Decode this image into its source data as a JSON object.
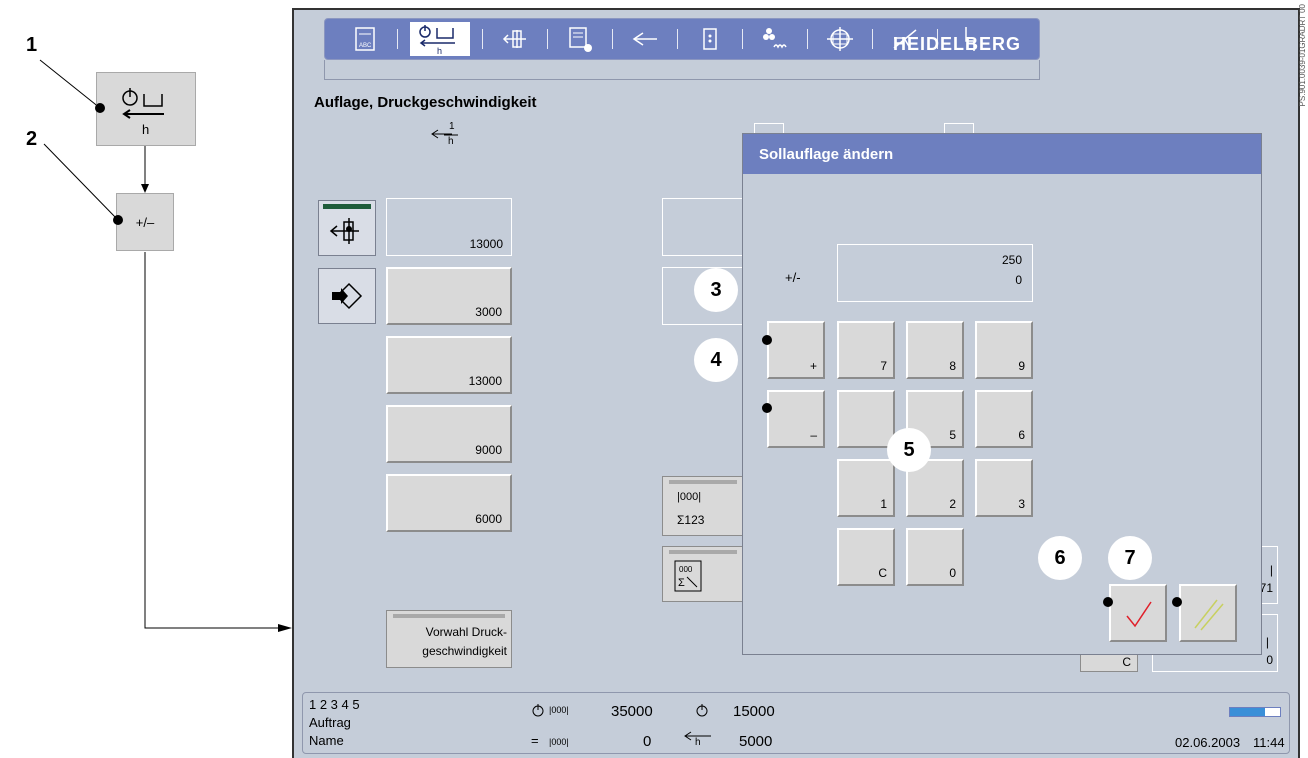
{
  "callouts": {
    "n1": "1",
    "n2": "2",
    "n3": "3",
    "n4": "4",
    "n5": "5",
    "n6": "6",
    "n7": "7"
  },
  "left_panel": {
    "h_label": "h",
    "plusminus_label": "+/–"
  },
  "toolbar": {
    "items": [
      "abc-doc-icon",
      "print-run-speed-icon",
      "register-icon",
      "job-scroll-icon",
      "feed-direction-icon",
      "door-icon",
      "ink-dots-icon",
      "register-cross-icon",
      "sensor-icon",
      "step-icon"
    ],
    "active_h_label": "h",
    "logo": "HEIDELBERG"
  },
  "page": {
    "title": "Auflage, Druckgeschwindigkeit",
    "speed_symbol_top": "1",
    "speed_symbol_bottom": "h"
  },
  "values": [
    "13000",
    "3000",
    "13000",
    "9000",
    "6000"
  ],
  "preselect_button": {
    "line1": "Vorwahl Druck-",
    "line2": "geschwindigkeit"
  },
  "counter_button": {
    "line1": "|000|",
    "line2": "Σ123"
  },
  "behind_panel": {
    "c_label": "C",
    "val71": "71",
    "val0": "0",
    "bar_mark": "|"
  },
  "dialog": {
    "title": "Sollauflage ändern",
    "plusminus": "+/-",
    "display_line1": "250",
    "display_line2": "0",
    "keys": {
      "plus": "+",
      "minus": "–",
      "k7": "7",
      "k8": "8",
      "k9": "9",
      "k4": "",
      "k5": "5",
      "k6": "6",
      "k1": "1",
      "k2": "2",
      "k3": "3",
      "kc": "C",
      "k0": "0"
    }
  },
  "status": {
    "slots": "1 2 3 4 5",
    "job_label": "Auftrag",
    "name_label": "Name",
    "counter_total": "35000",
    "counter_target": "15000",
    "counter_good": "0",
    "speed": "5000",
    "counter_unit": "|000|",
    "h_unit": "h",
    "date": "02.06.2003",
    "time": "11:44",
    "progress_fraction": 0.7
  },
  "side_code": "PS.901.0039-01GRADRT 00",
  "colors": {
    "screen_bg": "#c5cdd9",
    "title_bar": "#6d7fbf",
    "button_face": "#d9d9d9",
    "check_red": "#e0202a",
    "cancel_yellow": "#c8d060",
    "progress_blue": "#3a8fd8"
  }
}
